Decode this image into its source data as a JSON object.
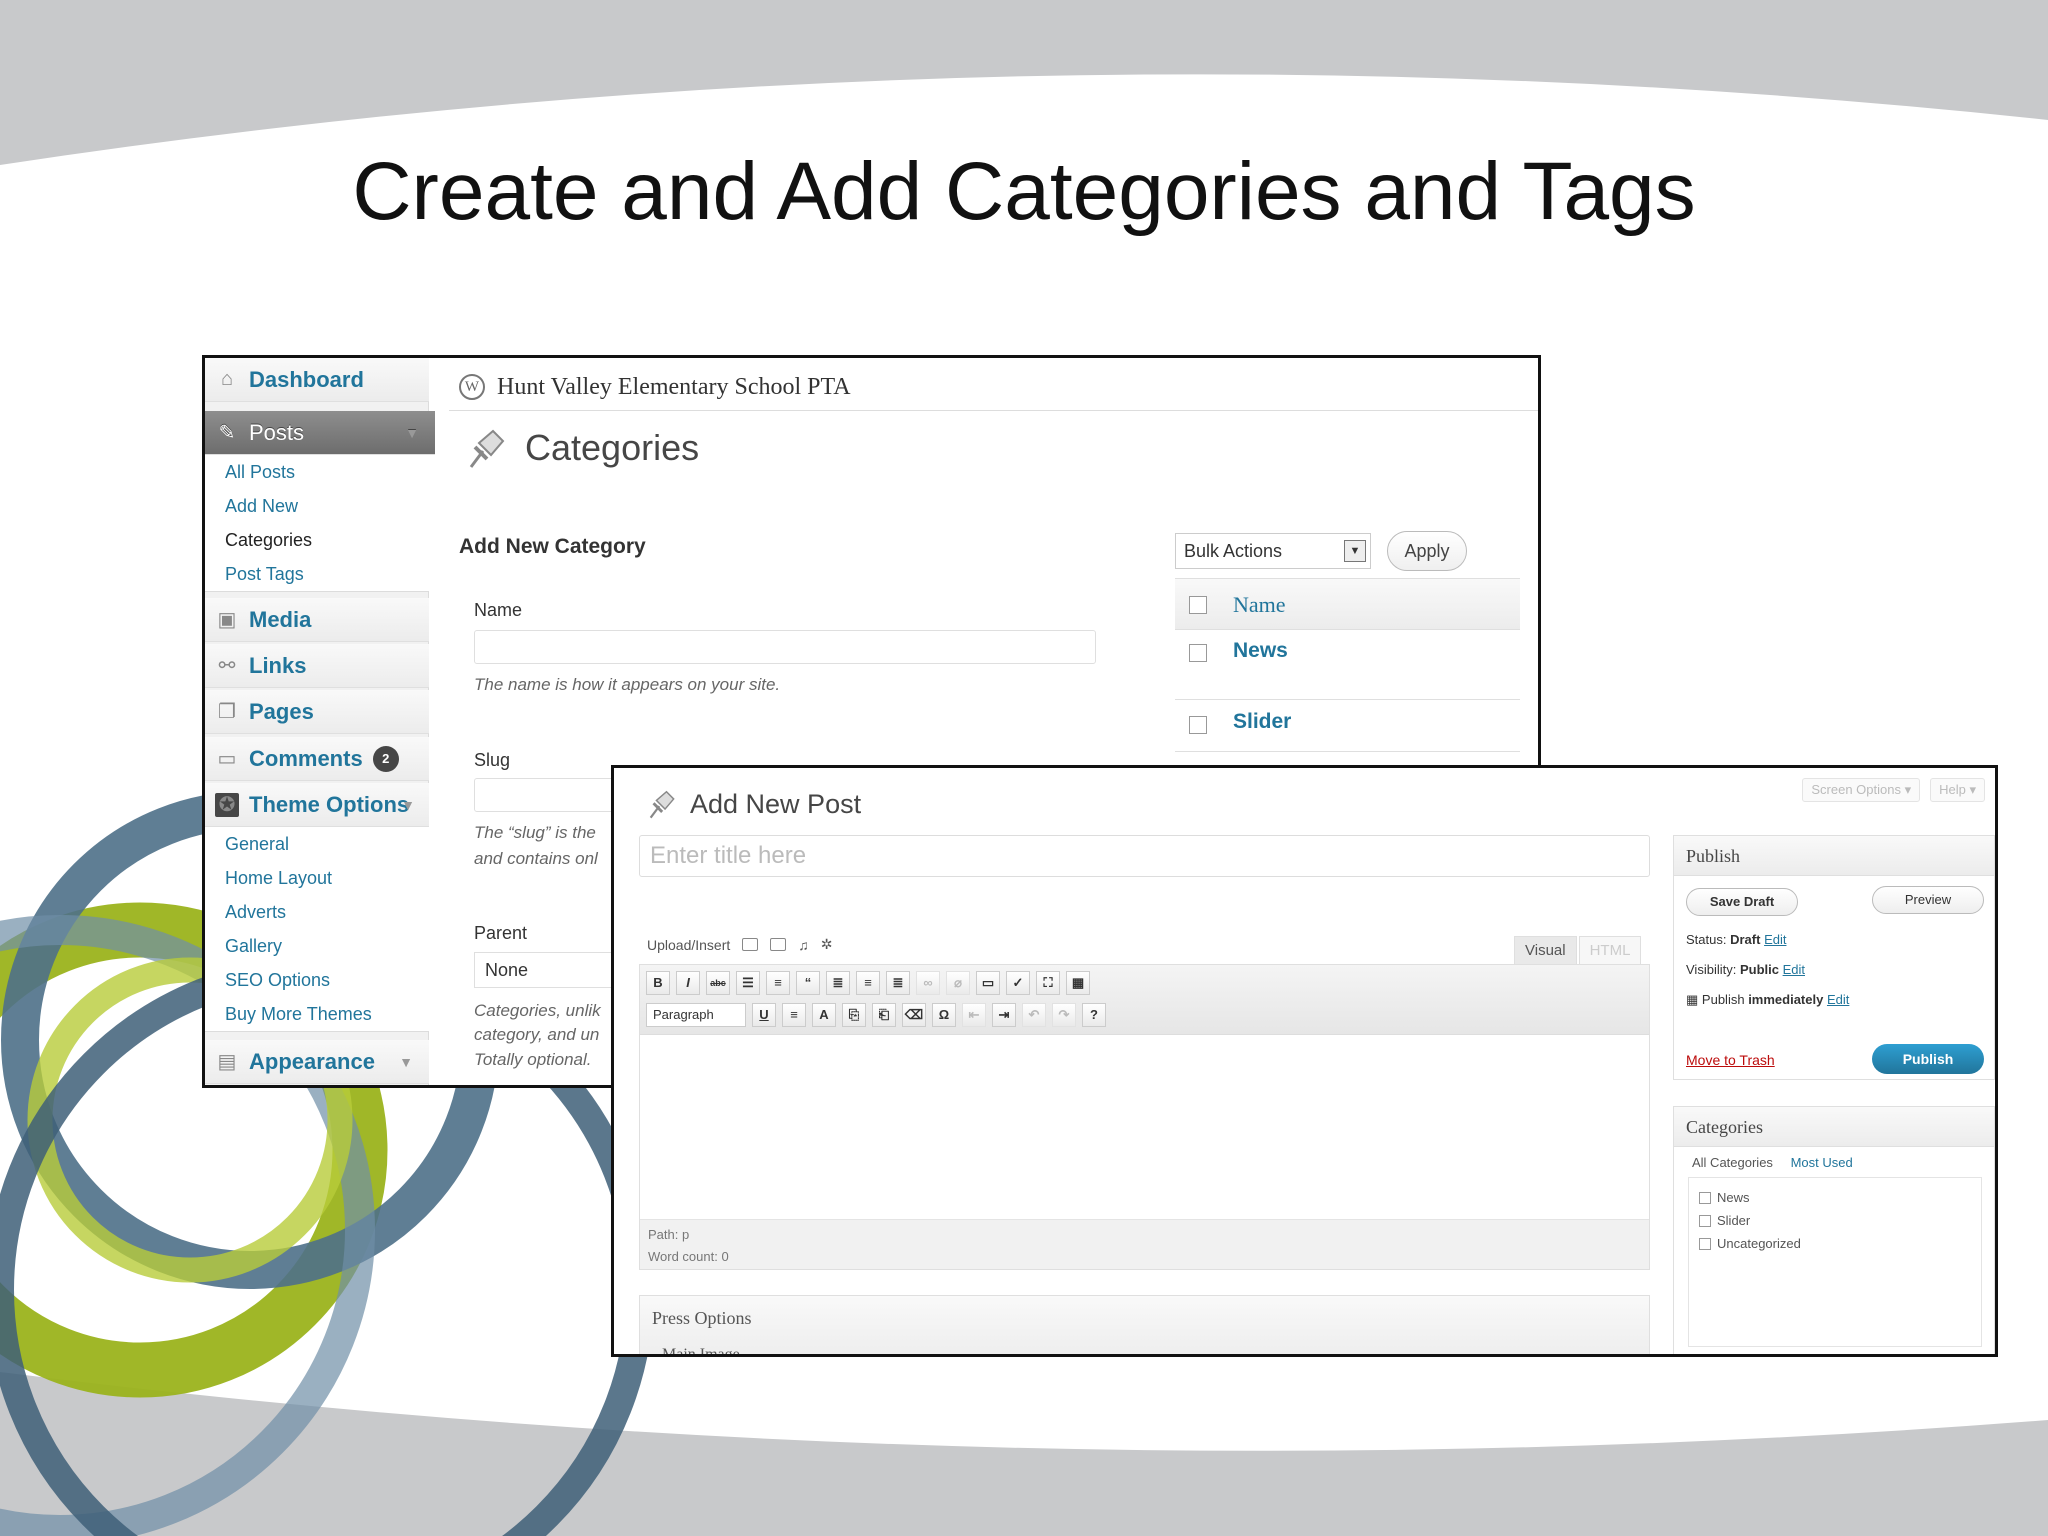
{
  "slide": {
    "title": "Create and Add Categories and Tags"
  },
  "admin_menu": {
    "dashboard": "Dashboard",
    "posts": "Posts",
    "posts_sub": [
      "All Posts",
      "Add New",
      "Categories",
      "Post Tags"
    ],
    "media": "Media",
    "links": "Links",
    "pages": "Pages",
    "comments": "Comments",
    "comments_count": "2",
    "theme_options": "Theme Options",
    "theme_sub": [
      "General",
      "Home Layout",
      "Adverts",
      "Gallery",
      "SEO Options",
      "Buy More Themes"
    ],
    "appearance": "Appearance"
  },
  "categories_page": {
    "site_name": "Hunt Valley Elementary School PTA",
    "heading": "Categories",
    "form_title": "Add New Category",
    "name_label": "Name",
    "name_value": "",
    "name_hint": "The name is how it appears on your site.",
    "slug_label": "Slug",
    "slug_value": "",
    "slug_hint_1": "The “slug” is the",
    "slug_hint_2": "and contains onl",
    "parent_label": "Parent",
    "parent_value": "None",
    "parent_hint_1": "Categories, unlik",
    "parent_hint_2": "category, and un",
    "parent_hint_3": "Totally optional.",
    "bulk_actions": "Bulk Actions",
    "apply": "Apply",
    "table_header": "Name",
    "rows": [
      "News",
      "Slider"
    ]
  },
  "post_editor": {
    "screen_options": "Screen Options ▾",
    "help": "Help ▾",
    "heading": "Add New Post",
    "title_placeholder": "Enter title here",
    "upload_insert": "Upload/Insert",
    "tab_visual": "Visual",
    "tab_html": "HTML",
    "format_select": "Paragraph",
    "path": "Path: p",
    "word_count": "Word count: 0",
    "press_options": "Press Options",
    "press_sub": "Main Image",
    "publish_box": {
      "title": "Publish",
      "save_draft": "Save Draft",
      "preview": "Preview",
      "status_label": "Status:",
      "status_value": "Draft",
      "visibility_label": "Visibility:",
      "visibility_value": "Public",
      "publish_label": "Publish",
      "publish_value": "immediately",
      "edit": "Edit",
      "trash": "Move to Trash",
      "publish_btn": "Publish"
    },
    "categories_box": {
      "title": "Categories",
      "tab_all": "All Categories",
      "tab_most": "Most Used",
      "items": [
        "News",
        "Slider",
        "Uncategorized"
      ]
    }
  },
  "colors": {
    "link_blue": "#21759b",
    "swoosh_gray": "#c8c9cb",
    "green": "#9bb31c",
    "slate_blue": "#4e7088"
  }
}
